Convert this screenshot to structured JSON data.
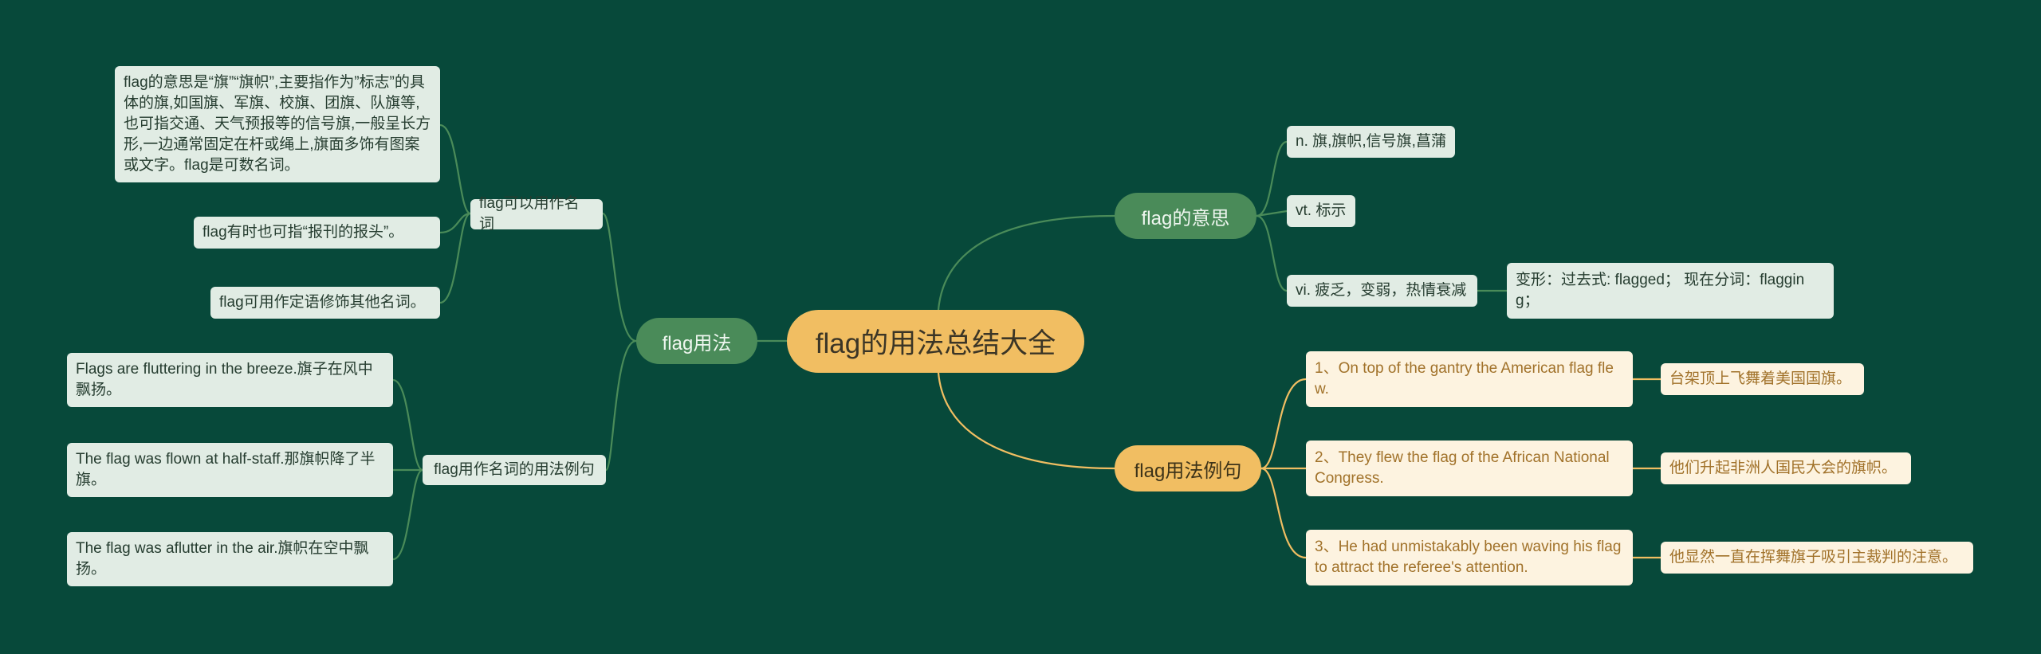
{
  "root": {
    "label": "flag的用法总结大全"
  },
  "left": {
    "branch": "flag用法",
    "groups": [
      {
        "label": "flag可以用作名词",
        "items": [
          "flag的意思是“旗”“旗帜”,主要指作为”标志”的具体的旗,如国旗、军旗、校旗、团旗、队旗等,也可指交通、天气预报等的信号旗,一般呈长方形,一边通常固定在杆或绳上,旗面多饰有图案或文字。flag是可数名词。",
          "flag有时也可指“报刊的报头”。",
          "flag可用作定语修饰其他名词。"
        ]
      },
      {
        "label": "flag用作名词的用法例句",
        "items": [
          "Flags are fluttering in the breeze.旗子在风中飘扬。",
          "The flag was flown at half-staff.那旗帜降了半旗。",
          "The flag was aflutter in the air.旗帜在空中飘扬。"
        ]
      }
    ]
  },
  "meaning": {
    "branch": "flag的意思",
    "items": [
      "n. 旗,旗帜,信号旗,菖蒲",
      "vt. 标示",
      "vi. 疲乏，变弱，热情衰减"
    ],
    "sub": "变形：过去式: flagged； 现在分词：flagging；"
  },
  "examples": {
    "branch": "flag用法例句",
    "items": [
      {
        "en": "1、On top of the gantry the American flag flew.",
        "zh": "台架顶上飞舞着美国国旗。"
      },
      {
        "en": "2、They flew the flag of the African National Congress.",
        "zh": "他们升起非洲人国民大会的旗帜。"
      },
      {
        "en": "3、He had unmistakably been waving his flag to attract the referee's attention.",
        "zh": "他显然一直在挥舞旗子吸引主裁判的注意。"
      }
    ]
  },
  "colors": {
    "background": "#07493a",
    "green_link": "#4a8b59",
    "gold_link": "#f1be62"
  }
}
